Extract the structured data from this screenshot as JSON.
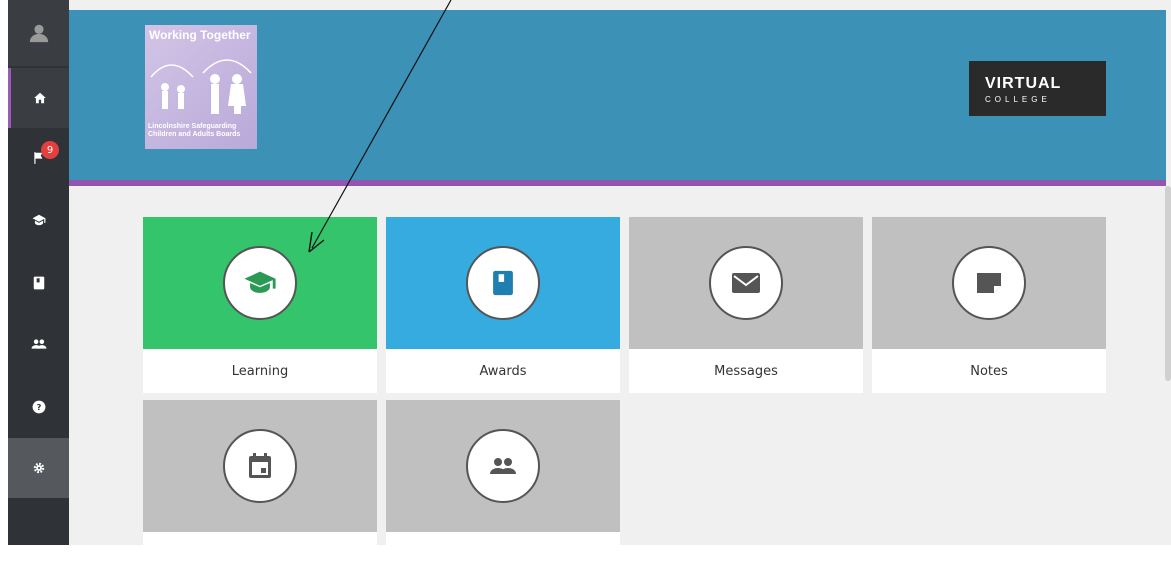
{
  "sidebar": {
    "notification_count": "9",
    "items": [
      {
        "icon": "user-icon"
      },
      {
        "icon": "home-icon"
      },
      {
        "icon": "flag-icon"
      },
      {
        "icon": "graduation-cap-icon"
      },
      {
        "icon": "book-icon"
      },
      {
        "icon": "users-icon"
      },
      {
        "icon": "help-icon"
      },
      {
        "icon": "gear-icon"
      }
    ]
  },
  "banner": {
    "logo_title": "Working Together",
    "logo_subtitle": "Lincolnshire Safeguarding Children and Adults Boards",
    "partner_logo_main": "VIRTUAL",
    "partner_logo_sub": "COLLEGE"
  },
  "tiles": [
    {
      "label": "Learning",
      "icon": "graduation-cap-icon",
      "color": "#33c46c"
    },
    {
      "label": "Awards",
      "icon": "book-icon",
      "color": "#36abe0"
    },
    {
      "label": "Messages",
      "icon": "envelope-icon",
      "color": "#c0c0c0"
    },
    {
      "label": "Notes",
      "icon": "note-icon",
      "color": "#c0c0c0"
    },
    {
      "label": "",
      "icon": "calendar-icon",
      "color": "#c0c0c0"
    },
    {
      "label": "",
      "icon": "users-icon",
      "color": "#c0c0c0"
    }
  ],
  "colors": {
    "sidebar": "#2f3237",
    "banner": "#3c91b6",
    "accent": "#9356b0",
    "learning": "#33c46c",
    "awards": "#36abe0",
    "grey_tile": "#c0c0c0"
  }
}
